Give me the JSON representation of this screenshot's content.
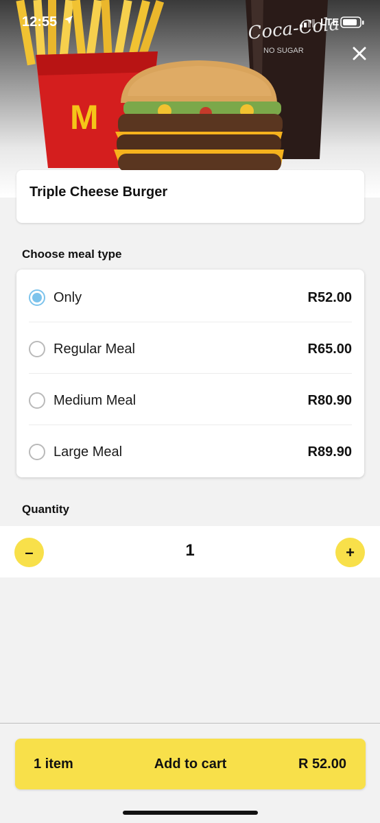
{
  "status_bar": {
    "time": "12:55",
    "network": "LTE"
  },
  "hero": {
    "drink_brand": "Coca-Cola",
    "drink_sub": "NO SUGAR",
    "fries_logo": "M"
  },
  "product": {
    "name": "Triple Cheese Burger"
  },
  "meal_type": {
    "label": "Choose meal type",
    "options": [
      {
        "label": "Only",
        "price": "R52.00",
        "selected": true
      },
      {
        "label": "Regular Meal",
        "price": "R65.00",
        "selected": false
      },
      {
        "label": "Medium Meal",
        "price": "R80.90",
        "selected": false
      },
      {
        "label": "Large Meal",
        "price": "R89.90",
        "selected": false
      }
    ]
  },
  "quantity": {
    "label": "Quantity",
    "value": "1",
    "minus": "–",
    "plus": "+"
  },
  "cart": {
    "items": "1 item",
    "cta": "Add to cart",
    "total": "R 52.00"
  },
  "colors": {
    "accent": "#f8e04a",
    "radio_selected": "#7cc3ec",
    "background": "#f2f2f2"
  }
}
